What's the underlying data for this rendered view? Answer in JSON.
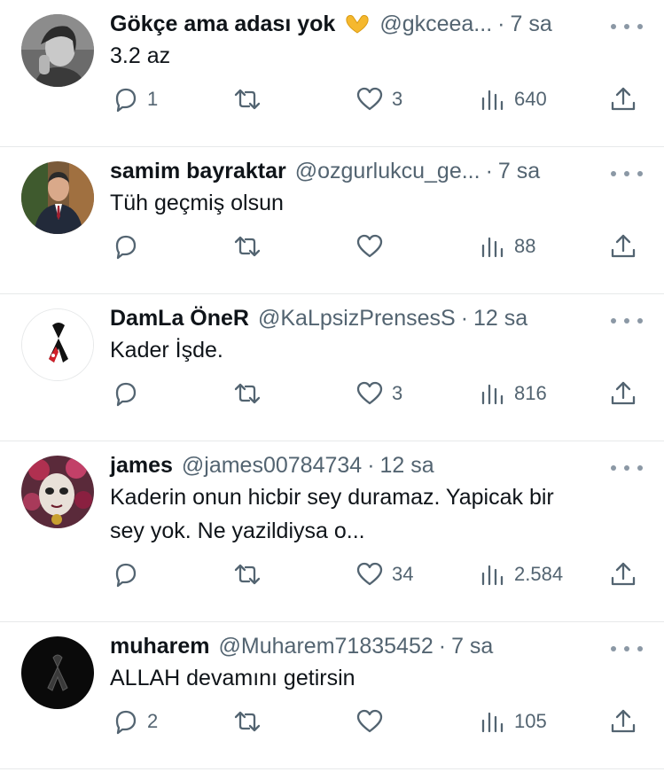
{
  "tweets": [
    {
      "name": "Gökçe ama adası yok",
      "emoji": "heart-hands-emoji",
      "handle": "@gkceea...",
      "time": "7 sa",
      "text": "3.2 az",
      "replies": "1",
      "retweets": "",
      "likes": "3",
      "views": "640"
    },
    {
      "name": "samim bayraktar",
      "handle": "@ozgurlukcu_ge...",
      "time": "7 sa",
      "text": "Tüh geçmiş olsun",
      "replies": "",
      "retweets": "",
      "likes": "",
      "views": "88"
    },
    {
      "name": "DamLa ÖneR",
      "handle": "@KaLpsizPrensesS",
      "time": "12 sa",
      "text": "Kader İşde.",
      "replies": "",
      "retweets": "",
      "likes": "3",
      "views": "816"
    },
    {
      "name": "james",
      "handle": "@james00784734",
      "time": "12 sa",
      "text_line1": "Kaderin onun hicbir sey duramaz. Yapicak bir",
      "text_line2": "sey yok. Ne yazildiysa o...",
      "replies": "",
      "retweets": "",
      "likes": "34",
      "views": "2.584"
    },
    {
      "name": "muharem",
      "handle": "@Muharem71835452",
      "time": "7 sa",
      "text": "ALLAH devamını getirsin",
      "replies": "2",
      "retweets": "",
      "likes": "",
      "views": "105"
    }
  ],
  "separator": "·",
  "colors": {
    "text": "#0f1419",
    "muted": "#536471",
    "border": "#e7e9ea",
    "emoji": "#f5b82e"
  }
}
